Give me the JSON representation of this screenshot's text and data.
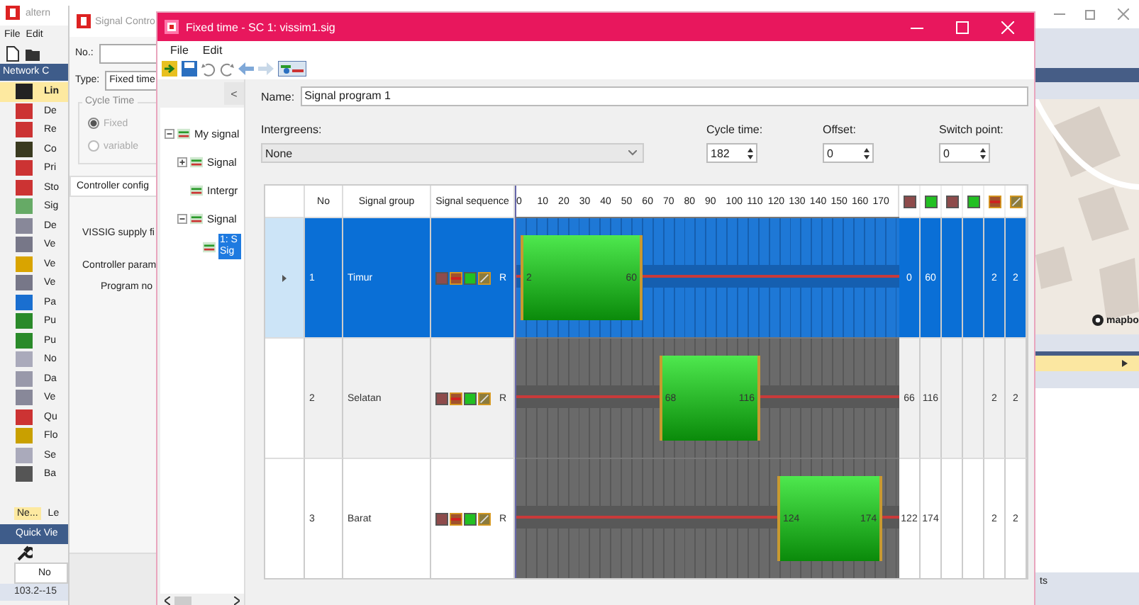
{
  "background_app": {
    "title": "altern",
    "menu": [
      "File",
      "Edit"
    ],
    "panel_title": "Network C",
    "items": [
      {
        "label": "Lin",
        "selected": true
      },
      {
        "label": "De",
        "selected": false
      },
      {
        "label": "Re",
        "selected": false
      },
      {
        "label": "Co",
        "selected": false
      },
      {
        "label": "Pri",
        "selected": false
      },
      {
        "label": "Sto",
        "selected": false
      },
      {
        "label": "Sig",
        "selected": false
      },
      {
        "label": "De",
        "selected": false
      },
      {
        "label": "Ve",
        "selected": false
      },
      {
        "label": "Ve",
        "selected": false
      },
      {
        "label": "Ve",
        "selected": false
      },
      {
        "label": "Pa",
        "selected": false
      },
      {
        "label": "Pu",
        "selected": false
      },
      {
        "label": "Pu",
        "selected": false
      },
      {
        "label": "No",
        "selected": false
      },
      {
        "label": "Da",
        "selected": false
      },
      {
        "label": "Ve",
        "selected": false
      },
      {
        "label": "Qu",
        "selected": false
      },
      {
        "label": "Flo",
        "selected": false
      },
      {
        "label": "Se",
        "selected": false
      },
      {
        "label": "Ba",
        "selected": false
      }
    ],
    "tabs": [
      {
        "label": "Ne...",
        "selected": true
      },
      {
        "label": "Le",
        "selected": false
      }
    ],
    "quick_view_title": "Quick Vie",
    "quick_view_column": "No",
    "quick_view_cell": "103.2--15",
    "map_logo": "mapbo",
    "bottom_text": "ts"
  },
  "signal_control_window": {
    "title": "Signal Contro",
    "no_label": "No.:",
    "type_label": "Type:",
    "type_value": "Fixed time",
    "cycle_group": "Cycle Time",
    "radios": [
      {
        "label": "Fixed",
        "selected": true,
        "disabled": true
      },
      {
        "label": "variable",
        "selected": false,
        "disabled": true
      }
    ],
    "config_tab": "Controller config",
    "supply_label": "VISSIG supply fi",
    "params": {
      "label": "Controller param",
      "children": [
        {
          "label": "Program no"
        }
      ]
    }
  },
  "main_window": {
    "title": "Fixed time - SC 1: vissim1.sig",
    "menu": [
      "File",
      "Edit"
    ],
    "collapse_button": "<",
    "tree": [
      {
        "label": "My signal",
        "expanded": true,
        "selected": false,
        "children": [
          {
            "label": "Signal",
            "expanded": false,
            "selected": false
          },
          {
            "label": "Intergr",
            "selected": false
          },
          {
            "label": "Signal",
            "expanded": true,
            "selected": false,
            "children": [
              {
                "label": "1: S Sig",
                "selected": true
              }
            ]
          }
        ]
      }
    ],
    "name_label": "Name:",
    "name_value": "Signal program 1",
    "intergreens_label": "Intergreens:",
    "intergreens_value": "None",
    "cycle_time": {
      "label": "Cycle time:",
      "value": "182"
    },
    "offset": {
      "label": "Offset:",
      "value": "0"
    },
    "switch_point": {
      "label": "Switch point:",
      "value": "0"
    },
    "table": {
      "columns": [
        "No",
        "Signal group",
        "Signal sequence"
      ],
      "ticks": [
        "0",
        "10",
        "20",
        "30",
        "40",
        "50",
        "60",
        "70",
        "80",
        "90",
        "100",
        "110",
        "120",
        "130",
        "140",
        "150",
        "160",
        "170"
      ],
      "state_columns": [
        {
          "kind": "red"
        },
        {
          "kind": "green"
        },
        {
          "kind": "red"
        },
        {
          "kind": "green"
        },
        {
          "kind": "red_amber"
        },
        {
          "kind": "amber"
        }
      ],
      "rows": [
        {
          "selected": true,
          "no": "1",
          "group": "Timur",
          "sequence": [
            {
              "kind": "red"
            },
            {
              "kind": "red_amber"
            },
            {
              "kind": "green"
            },
            {
              "kind": "amber"
            }
          ],
          "sequence_label": "R",
          "green_start": "2",
          "green_end": "60",
          "cells": [
            {
              "value": "0"
            },
            {
              "value": "60"
            },
            {},
            {},
            {
              "value": "2"
            },
            {
              "value": "2"
            }
          ]
        },
        {
          "selected": false,
          "no": "2",
          "group": "Selatan",
          "sequence": [
            {
              "kind": "red"
            },
            {
              "kind": "red_amber"
            },
            {
              "kind": "green"
            },
            {
              "kind": "amber"
            }
          ],
          "sequence_label": "R",
          "green_start": "68",
          "green_end": "116",
          "cells": [
            {
              "value": "66"
            },
            {
              "value": "116"
            },
            {},
            {},
            {
              "value": "2"
            },
            {
              "value": "2"
            }
          ]
        },
        {
          "selected": false,
          "no": "3",
          "group": "Barat",
          "sequence": [
            {
              "kind": "red"
            },
            {
              "kind": "red_amber"
            },
            {
              "kind": "green"
            },
            {
              "kind": "amber"
            }
          ],
          "sequence_label": "R",
          "green_start": "124",
          "green_end": "174",
          "cells": [
            {
              "value": "122"
            },
            {
              "value": "174"
            },
            {},
            {},
            {
              "value": "2"
            },
            {
              "value": "2"
            }
          ]
        }
      ]
    }
  }
}
